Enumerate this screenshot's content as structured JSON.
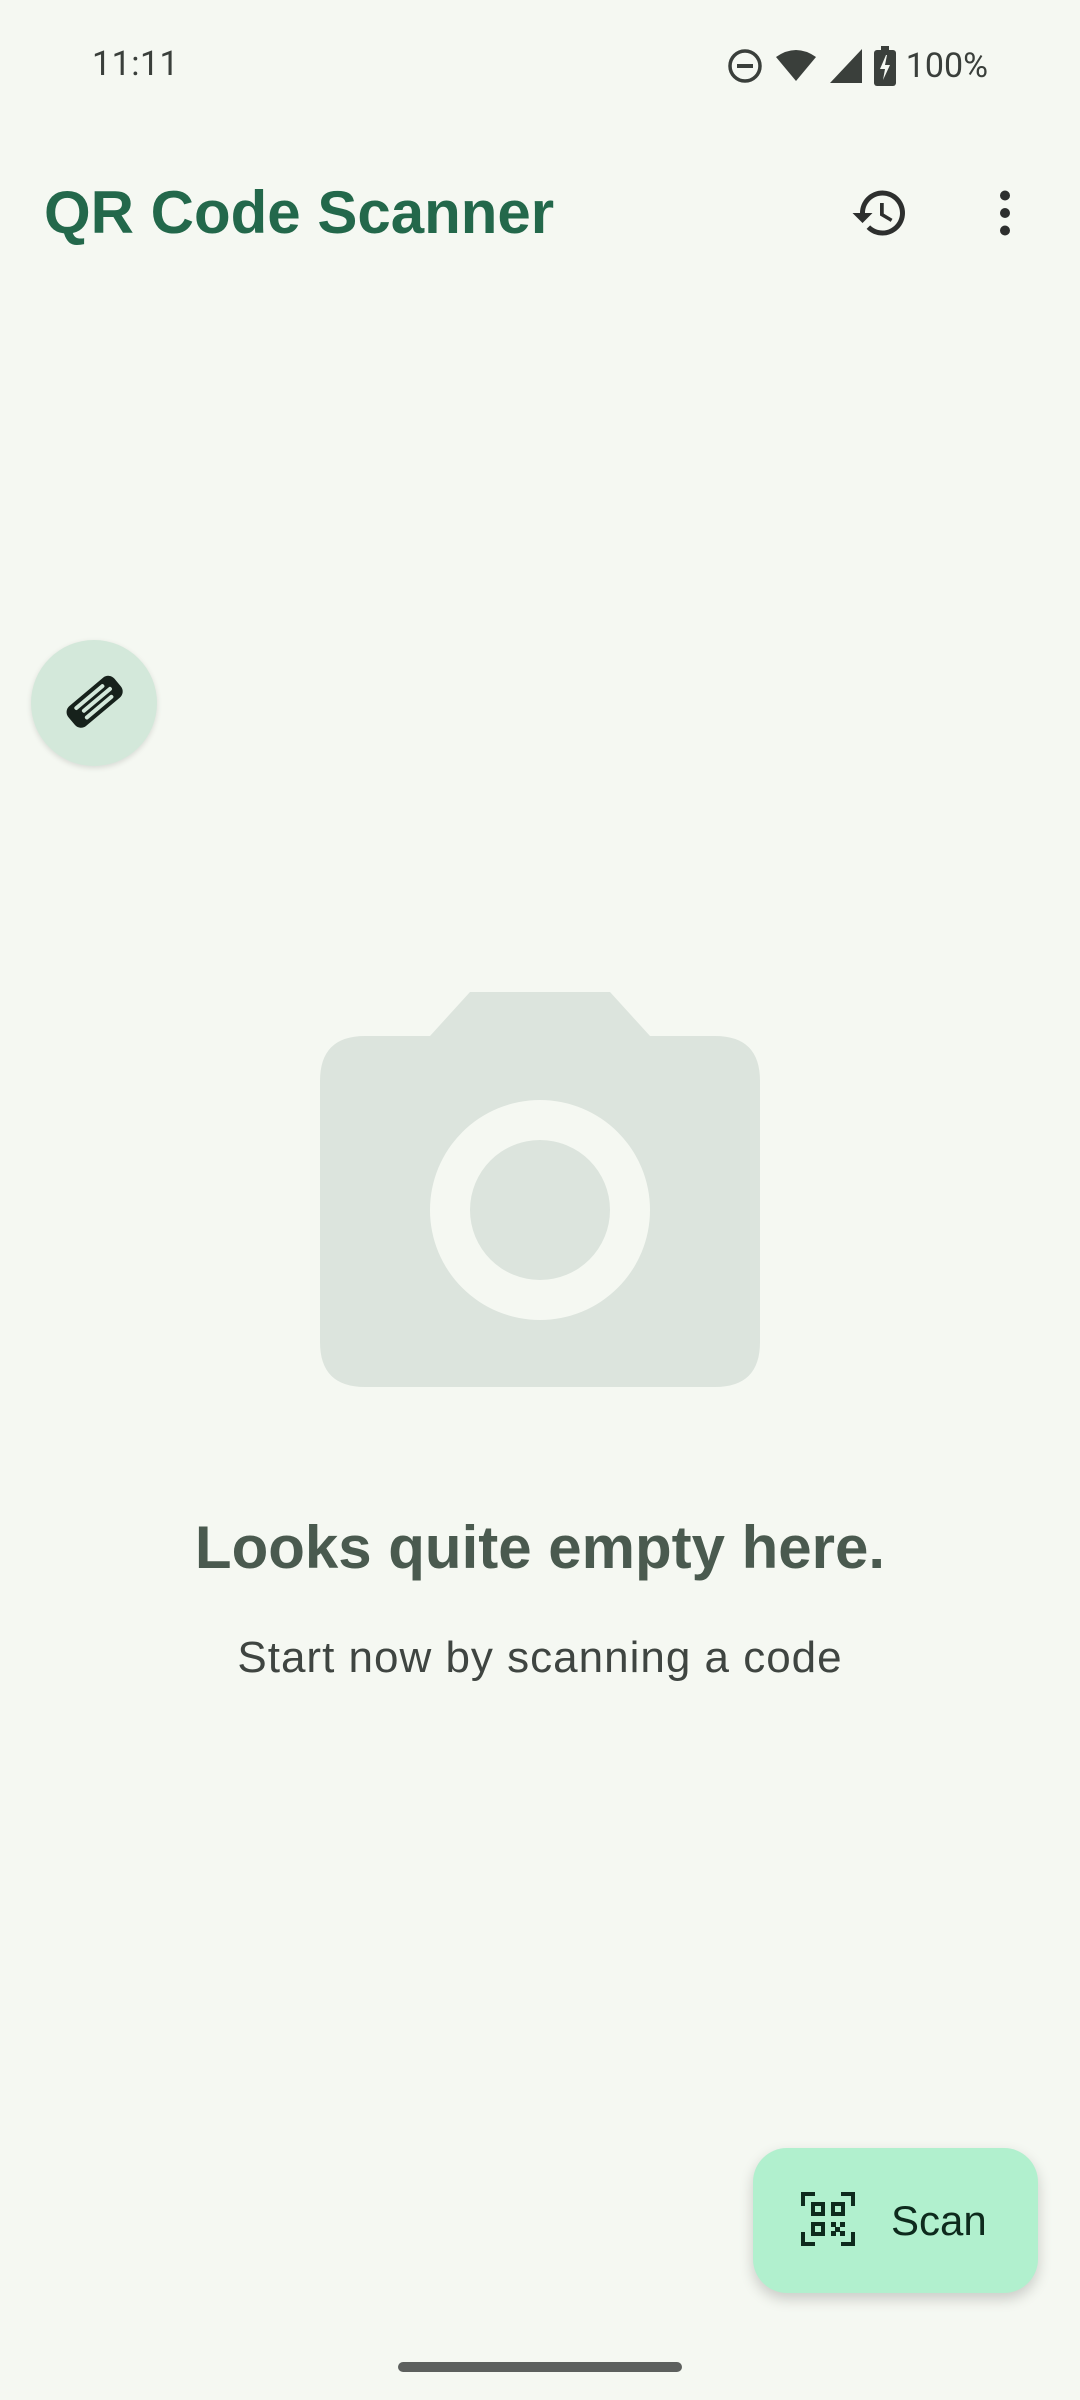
{
  "status_bar": {
    "time": "11:11",
    "battery": "100%",
    "icons": [
      "do-not-disturb-icon",
      "wifi-icon",
      "signal-icon",
      "battery-icon"
    ]
  },
  "app_bar": {
    "title": "QR Code Scanner",
    "actions": [
      "history-icon",
      "more-vert-icon"
    ]
  },
  "donate_button": {
    "icon": "handshake-icon"
  },
  "empty_state": {
    "icon": "camera-icon",
    "title": "Looks quite empty here.",
    "subtitle": "Start now by scanning a code"
  },
  "scan_fab": {
    "label": "Scan",
    "icon": "qr-code-scanner-icon"
  },
  "colors": {
    "background": "#F5F8F2",
    "title_green": "#23684B",
    "fab_green": "#B1F0CE",
    "donate_bg": "#D3E8DA",
    "illustration": "#DCE4DD"
  }
}
